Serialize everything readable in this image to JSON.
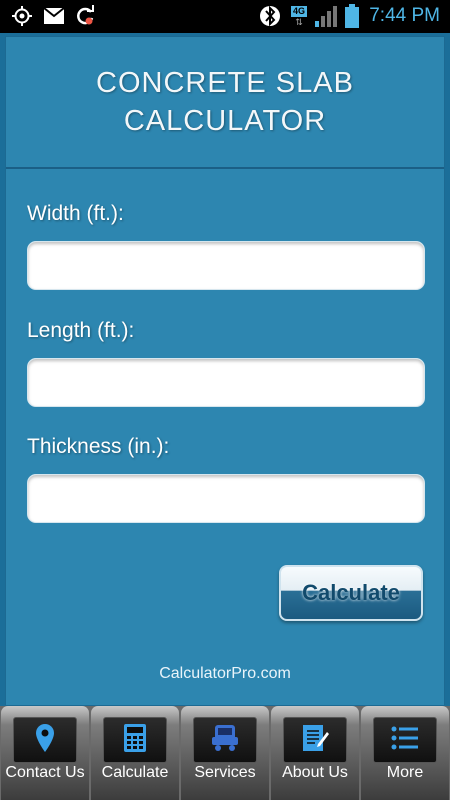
{
  "status_bar": {
    "time": "7:44 PM",
    "left_icons": [
      "gps-icon",
      "gmail-icon",
      "sync-icon"
    ],
    "right_icons": [
      "bluetooth-icon",
      "4g-icon",
      "signal-icon",
      "battery-icon"
    ],
    "network_label": "4G"
  },
  "app": {
    "title": "CONCRETE SLAB CALCULATOR",
    "fields": [
      {
        "label": "Width (ft.):",
        "value": "",
        "placeholder": ""
      },
      {
        "label": "Length (ft.):",
        "value": "",
        "placeholder": ""
      },
      {
        "label": "Thickness (in.):",
        "value": "",
        "placeholder": ""
      }
    ],
    "calculate_button": "Calculate",
    "footer": "CalculatorPro.com"
  },
  "bottom_nav": [
    {
      "label": "Contact Us",
      "icon": "location-pin-icon"
    },
    {
      "label": "Calculate",
      "icon": "calculator-icon"
    },
    {
      "label": "Services",
      "icon": "truck-icon"
    },
    {
      "label": "About Us",
      "icon": "document-icon"
    },
    {
      "label": "More",
      "icon": "list-icon"
    }
  ],
  "colors": {
    "background": "#1b6e99",
    "panel": "#2d86b0",
    "time_text": "#4fb6e6",
    "nav_icon_blue": "#3aa0e8"
  }
}
